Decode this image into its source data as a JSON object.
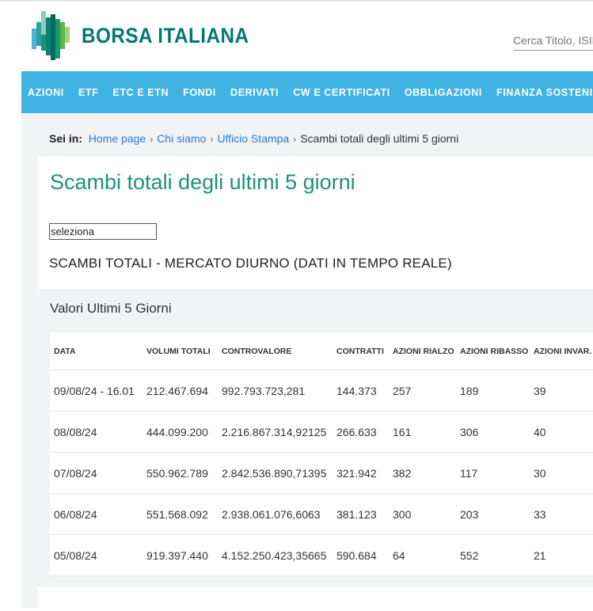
{
  "header": {
    "brand": "BORSA ITALIANA",
    "search_placeholder": "Cerca Titolo, ISIN"
  },
  "nav": [
    "AZIONI",
    "ETF",
    "ETC E ETN",
    "FONDI",
    "DERIVATI",
    "CW E CERTIFICATI",
    "OBBLIGAZIONI",
    "FINANZA SOSTENIBILE"
  ],
  "breadcrumb": {
    "label": "Sei in:",
    "items": [
      "Home page",
      "Chi siamo",
      "Ufficio Stampa"
    ],
    "current": "Scambi totali degli ultimi 5 giorni"
  },
  "page": {
    "title": "Scambi totali degli ultimi 5 giorni",
    "select_value": "seleziona",
    "subtitle": "SCAMBI TOTALI - MERCATO DIURNO (DATI IN TEMPO REALE)",
    "section": "Valori Ultimi 5 Giorni"
  },
  "table": {
    "columns": [
      "DATA",
      "VOLUMI TOTALI",
      "CONTROVALORE",
      "CONTRATTI",
      "AZIONI RIALZO",
      "AZIONI RIBASSO",
      "AZIONI INVAR."
    ],
    "rows": [
      [
        "09/08/24 - 16.01",
        "212.467.694",
        "992.793.723,281",
        "144.373",
        "257",
        "189",
        "39"
      ],
      [
        "08/08/24",
        "444.099.200",
        "2.216.867.314,92125",
        "266.633",
        "161",
        "306",
        "40"
      ],
      [
        "07/08/24",
        "550.962.789",
        "2.842.536.890,71395",
        "321.942",
        "382",
        "117",
        "30"
      ],
      [
        "06/08/24",
        "551.568.092",
        "2.938.061.076,6063",
        "381.123",
        "300",
        "203",
        "33"
      ],
      [
        "05/08/24",
        "919.397.440",
        "4.152.250.423,35665",
        "590.684",
        "64",
        "552",
        "21"
      ]
    ]
  }
}
